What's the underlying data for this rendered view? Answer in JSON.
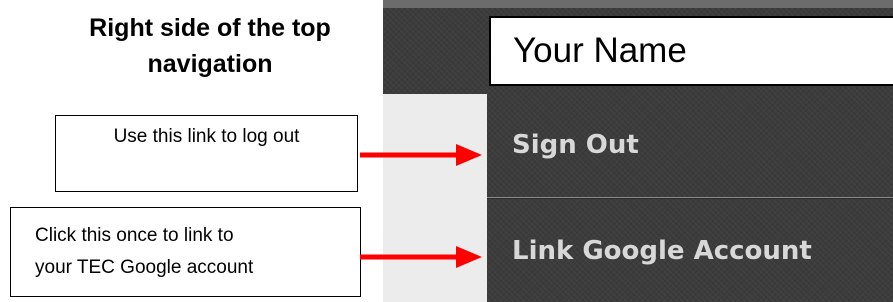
{
  "heading": {
    "line1": "Right side of the top",
    "line2": "navigation"
  },
  "callouts": {
    "logout": "Use this link to log out",
    "google_line1": "Click this once to link to",
    "google_line2": "your TEC Google account"
  },
  "nav": {
    "user_name": "Your Name",
    "sign_out_label": "Sign Out",
    "link_google_label": "Link Google Account"
  },
  "colors": {
    "arrow": "#ff0000",
    "nav_background": "#3c3c3c",
    "nav_text": "#d8d8d8"
  }
}
